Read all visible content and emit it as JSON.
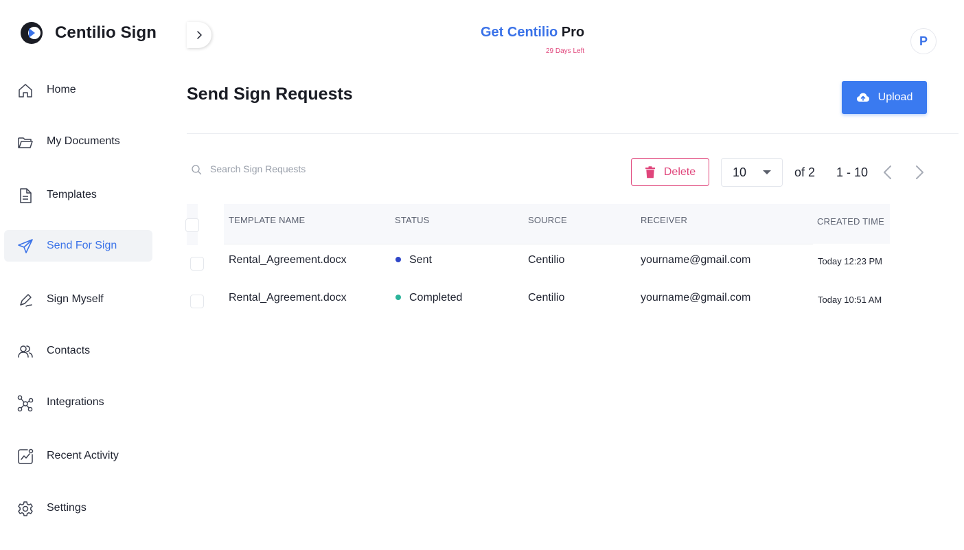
{
  "app": {
    "brand_name": "Centilio Sign",
    "colors": {
      "accent": "#3a72e8",
      "danger": "#e0457b",
      "sent": "#2f46c8",
      "completed": "#2bb39a"
    }
  },
  "sidebar": {
    "items": [
      {
        "label": "Home",
        "icon": "home-icon"
      },
      {
        "label": "My Documents",
        "icon": "folder-icon"
      },
      {
        "label": "Templates",
        "icon": "document-icon"
      },
      {
        "label": "Send For Sign",
        "icon": "send-icon",
        "active": true
      },
      {
        "label": "Sign Myself",
        "icon": "pen-icon"
      },
      {
        "label": "Contacts",
        "icon": "contacts-icon"
      },
      {
        "label": "Integrations",
        "icon": "integrations-icon"
      },
      {
        "label": "Recent Activity",
        "icon": "activity-icon"
      },
      {
        "label": "Settings",
        "icon": "gear-icon"
      }
    ]
  },
  "header": {
    "promo_part1": "Get Centilio",
    "promo_part2": " Pro",
    "days_left": "29 Days Left",
    "avatar_initial": "P"
  },
  "main": {
    "title": "Send Sign Requests",
    "upload_label": "Upload",
    "search_placeholder": "Search Sign Requests",
    "delete_label": "Delete",
    "page_size": "10",
    "of_pages": "of 2",
    "range": "1 - 10"
  },
  "table": {
    "headers": [
      "TEMPLATE NAME",
      "STATUS",
      "SOURCE",
      "RECEIVER",
      "CREATED TIME"
    ],
    "rows": [
      {
        "template_name": "Rental_Agreement.docx",
        "status": "Sent",
        "source": "Centilio",
        "receiver": "yourname@gmail.com",
        "created_time": "Today 12:23 PM"
      },
      {
        "template_name": "Rental_Agreement.docx",
        "status": "Completed",
        "source": "Centilio",
        "receiver": "yourname@gmail.com",
        "created_time": "Today 10:51 AM"
      }
    ]
  }
}
